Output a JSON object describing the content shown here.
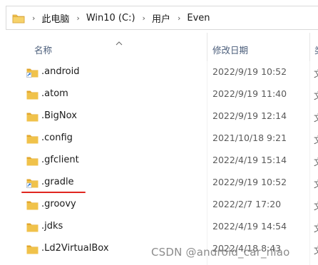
{
  "address_bar": {
    "crumbs": [
      "此电脑",
      "Win10 (C:)",
      "用户",
      "Even"
    ]
  },
  "columns": {
    "name": "名称",
    "date": "修改日期",
    "type": "类"
  },
  "files": [
    {
      "name": ".android",
      "date": "2022/9/19 10:52",
      "type": "文",
      "shortcut": true
    },
    {
      "name": ".atom",
      "date": "2022/9/19 11:40",
      "type": "文",
      "shortcut": false
    },
    {
      "name": ".BigNox",
      "date": "2022/9/19 12:14",
      "type": "文",
      "shortcut": false
    },
    {
      "name": ".config",
      "date": "2021/10/18 9:21",
      "type": "文",
      "shortcut": false
    },
    {
      "name": ".gfclient",
      "date": "2022/4/19 15:14",
      "type": "文",
      "shortcut": false
    },
    {
      "name": ".gradle",
      "date": "2022/9/19 10:52",
      "type": "文",
      "shortcut": true
    },
    {
      "name": ".groovy",
      "date": "2022/2/7 17:20",
      "type": "文",
      "shortcut": false
    },
    {
      "name": ".jdks",
      "date": "2022/4/19 14:54",
      "type": "文",
      "shortcut": false
    },
    {
      "name": ".Ld2VirtualBox",
      "date": "2022/4/18 8:43",
      "type": "文",
      "shortcut": false
    }
  ],
  "watermark": "CSDN @android_car_niao",
  "colors": {
    "folder": "#f0c24b",
    "folder_dark": "#e2a72e",
    "underline": "#e0261f",
    "header_text": "#4a5d7a"
  }
}
